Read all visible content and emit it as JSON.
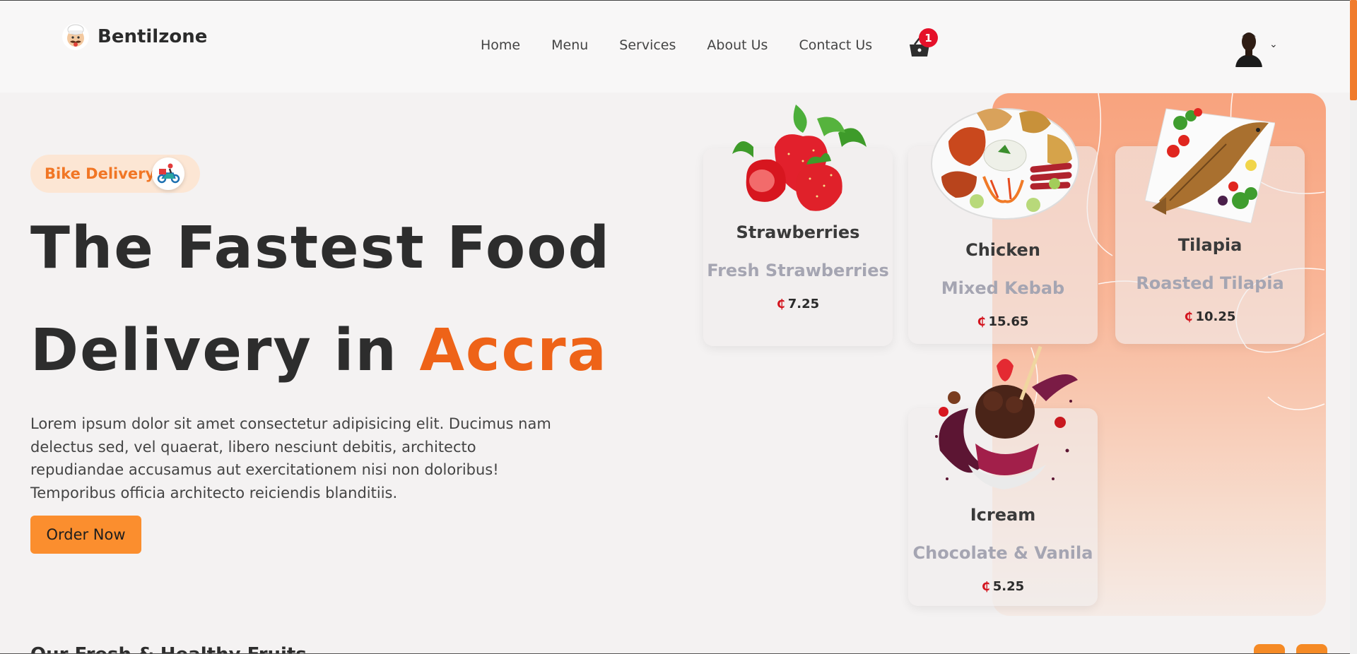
{
  "brand": {
    "name": "Bentilzone"
  },
  "nav": {
    "items": [
      {
        "label": "Home"
      },
      {
        "label": "Menu"
      },
      {
        "label": "Services"
      },
      {
        "label": "About Us"
      },
      {
        "label": "Contact Us"
      }
    ]
  },
  "cart": {
    "count": "1",
    "icon": "basket-icon"
  },
  "user": {
    "avatar_icon": "avatar",
    "menu_icon": "chevron-down-icon"
  },
  "hero": {
    "badge_label": "Bike Delivery",
    "badge_icon": "delivery-scooter-icon",
    "heading_line1": "The Fastest Food",
    "heading_line2_prefix": "Delivery in ",
    "heading_line2_accent": "Accra",
    "paragraph": "Lorem ipsum dolor sit amet consectetur adipisicing elit. Ducimus nam delectus sed, vel quaerat, libero nesciunt debitis, architecto repudiandae accusamus aut exercitationem nisi non doloribus! Temporibus officia architecto reiciendis blanditiis.",
    "cta_label": "Order Now"
  },
  "menu_cards": [
    {
      "title": "Strawberries",
      "subtitle": "Fresh Strawberries",
      "currency": "₵",
      "price": "7.25",
      "image": "strawberries"
    },
    {
      "title": "Chicken",
      "subtitle": "Mixed Kebab",
      "currency": "₵",
      "price": "15.65",
      "image": "kebab-platter"
    },
    {
      "title": "Tilapia",
      "subtitle": "Roasted Tilapia",
      "currency": "₵",
      "price": "10.25",
      "image": "grilled-fish"
    },
    {
      "title": "Icream",
      "subtitle": "Chocolate & Vanila",
      "currency": "₵",
      "price": "5.25",
      "image": "ice-cream"
    }
  ],
  "next_section": {
    "heading": "Our Fresh & Healthy Fruits"
  },
  "colors": {
    "accent": "#ee6318",
    "button": "#fb8e2e",
    "badge_bg": "#fce6d4",
    "price_symbol": "#d3141e",
    "hero_panel": "#f8a37e"
  }
}
